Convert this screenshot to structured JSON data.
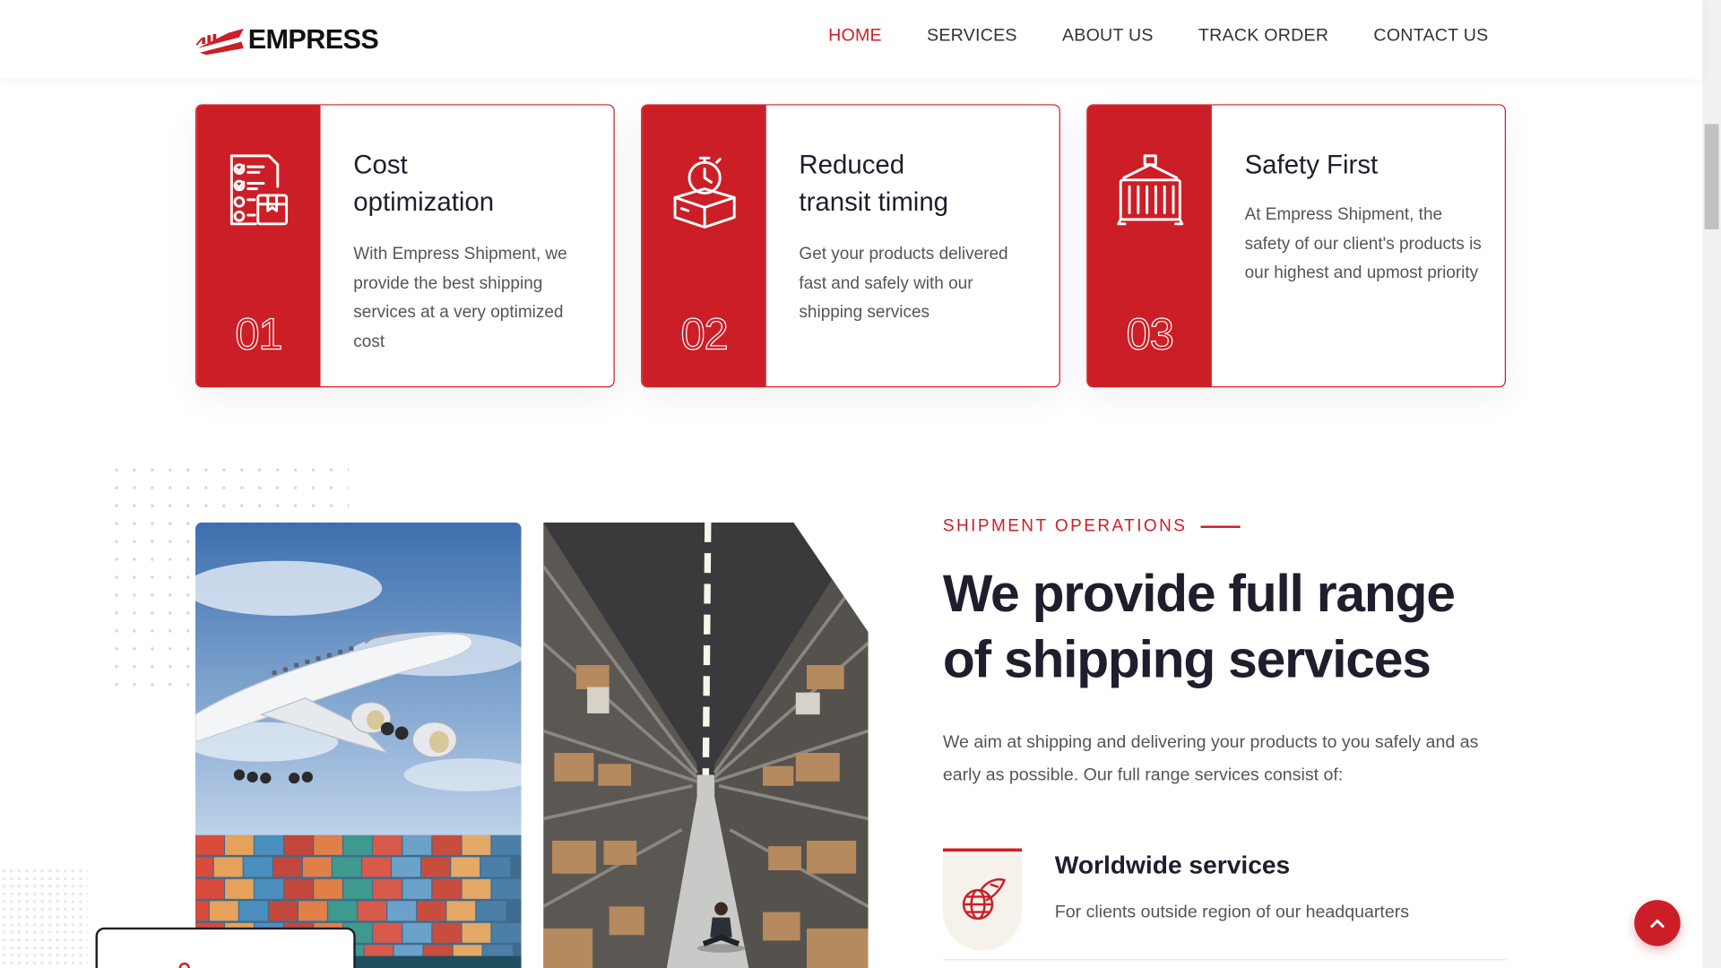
{
  "brand": {
    "name": "EMPRESS",
    "accent": "#cc1e26",
    "dark": "#1e1e2d"
  },
  "nav": {
    "items": [
      {
        "label": "HOME",
        "active": true
      },
      {
        "label": "SERVICES",
        "active": false
      },
      {
        "label": "ABOUT US",
        "active": false
      },
      {
        "label": "TRACK ORDER",
        "active": false
      },
      {
        "label": "CONTACT US",
        "active": false
      }
    ]
  },
  "features": [
    {
      "number": "01",
      "title_line1": "Cost",
      "title_line2": "optimization",
      "icon": "checklist-box-icon",
      "text": "With Empress Shipment, we provide the best shipping services at a very optimized cost"
    },
    {
      "number": "02",
      "title_line1": "Reduced",
      "title_line2": "transit timing",
      "icon": "stopwatch-box-icon",
      "text": "Get your products delivered fast and safely with our shipping services"
    },
    {
      "number": "03",
      "title_line1": "Safety First",
      "title_line2": "",
      "icon": "container-crane-icon",
      "text": "At Empress Shipment, the safety of our client's products is our highest and upmost priority"
    }
  ],
  "operations": {
    "eyebrow": "SHIPMENT OPERATIONS",
    "headline": "We provide full range of shipping services",
    "lead": "We aim at shipping and delivering your products to you safely and as early as possible. Our full range services consist of:",
    "services": [
      {
        "title": "Worldwide services",
        "text": "For clients outside region of our headquarters",
        "icon": "globe-plane-icon"
      }
    ]
  },
  "images": [
    {
      "alt": "airplane-over-containers-image"
    },
    {
      "alt": "warehouse-aisle-image"
    }
  ]
}
